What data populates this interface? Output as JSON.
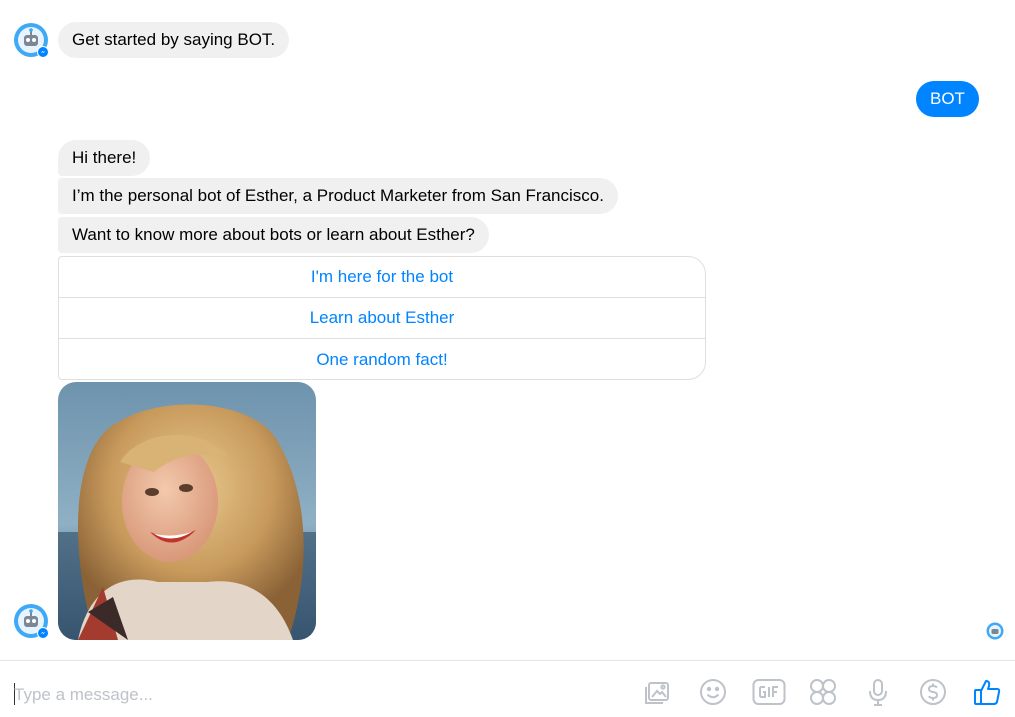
{
  "conversation": {
    "bot_intro": "Get started by saying BOT.",
    "user_message": "BOT",
    "bot_replies": [
      "Hi there!",
      "I’m the personal bot of Esther, a Product Marketer from San Francisco.",
      "Want to know more about bots or learn about Esther?"
    ],
    "quick_replies": [
      "I'm here for the bot",
      "Learn about Esther",
      "One random fact!"
    ]
  },
  "composer": {
    "placeholder": "Type a message..."
  },
  "icons": {
    "avatar": "robot-avatar-icon",
    "tools": [
      "photo-icon",
      "emoji-icon",
      "gif-icon",
      "sticker-icon",
      "microphone-icon",
      "payment-icon",
      "like-icon"
    ]
  },
  "colors": {
    "accent": "#0084ff",
    "bubble_gray": "#f1f0f0",
    "icon_gray": "#bec2c9"
  }
}
